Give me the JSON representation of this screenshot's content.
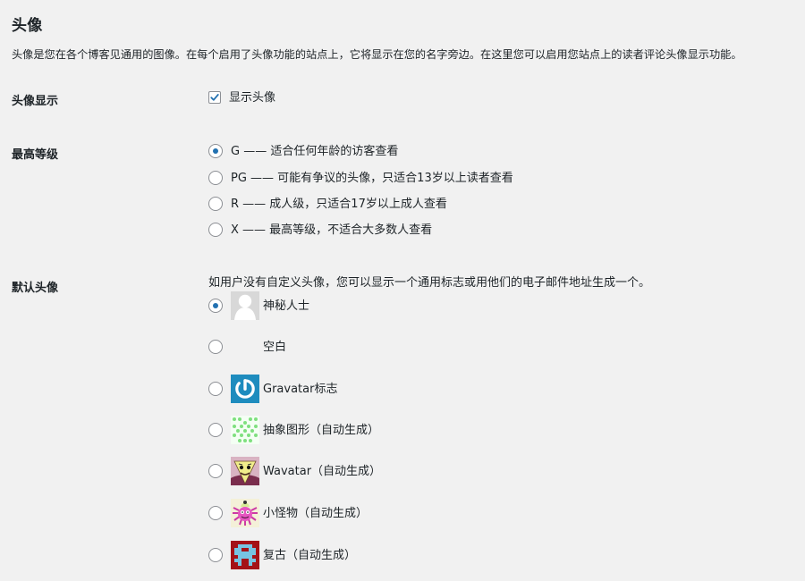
{
  "section": {
    "title": "头像",
    "description": "头像是您在各个博客见通用的图像。在每个启用了头像功能的站点上，它将显示在您的名字旁边。在这里您可以启用您站点上的读者评论头像显示功能。"
  },
  "avatar_display": {
    "label": "头像显示",
    "checkbox_label": "显示头像",
    "checked": true
  },
  "max_rating": {
    "label": "最高等级",
    "options": [
      {
        "label": "G —— 适合任何年龄的访客查看",
        "selected": true
      },
      {
        "label": "PG —— 可能有争议的头像，只适合13岁以上读者查看",
        "selected": false
      },
      {
        "label": "R —— 成人级，只适合17岁以上成人查看",
        "selected": false
      },
      {
        "label": "X —— 最高等级，不适合大多数人查看",
        "selected": false
      }
    ]
  },
  "default_avatar": {
    "label": "默认头像",
    "description": "如用户没有自定义头像，您可以显示一个通用标志或用他们的电子邮件地址生成一个。",
    "options": [
      {
        "label": "神秘人士",
        "icon": "mystery-person-icon",
        "selected": true
      },
      {
        "label": "空白",
        "icon": "blank-avatar-icon",
        "selected": false
      },
      {
        "label": "Gravatar标志",
        "icon": "gravatar-logo-icon",
        "selected": false
      },
      {
        "label": "抽象图形（自动生成）",
        "icon": "identicon-icon",
        "selected": false
      },
      {
        "label": "Wavatar（自动生成）",
        "icon": "wavatar-icon",
        "selected": false
      },
      {
        "label": "小怪物（自动生成）",
        "icon": "monsterid-icon",
        "selected": false
      },
      {
        "label": "复古（自动生成）",
        "icon": "retro-avatar-icon",
        "selected": false
      }
    ]
  },
  "colors": {
    "background": "#f1f1f1",
    "accent": "#2271b1",
    "text": "#1d2327"
  }
}
